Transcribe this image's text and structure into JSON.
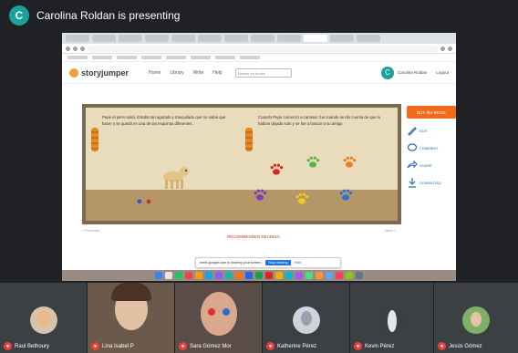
{
  "presenter": {
    "avatar_letter": "C",
    "text": "Carolina Roldan is presenting"
  },
  "storyjumper": {
    "logo": "storyjumper",
    "nav": [
      "Home",
      "Library",
      "Write",
      "Help"
    ],
    "search_placeholder": "Search for books",
    "user_initial": "C",
    "user_name": "Carolina Roldan",
    "logout": "Logout"
  },
  "book": {
    "left_text": "Pepe el perro salió, Estaba tan agotado y trasquilado que no sabía qué hacer y se quedó en una de las esquinas diferentes.",
    "right_text": "Cuando Pepe comenzó a caminar, fue cuando se dio cuenta de que lo habían dejado solo y se fue a buscar a su amigo.",
    "footer_link": "RECOMMENDED READING",
    "pager_left": "« Previous",
    "pager_right": "Next »"
  },
  "side_actions": {
    "buy": "BUY this BOOK",
    "items": [
      "EDIT",
      "COMMENT",
      "SHARE",
      "DOWNLOAD"
    ]
  },
  "share_notice": {
    "text": "meet.google.com is sharing your screen.",
    "stop": "Stop sharing",
    "hide": "Hide"
  },
  "participants": [
    {
      "name": "Raul Bethoury",
      "video": false
    },
    {
      "name": "Lina Isabel P",
      "video": true
    },
    {
      "name": "Sara Gómez Mor",
      "video": true
    },
    {
      "name": "Katherine Pérez",
      "video": false
    },
    {
      "name": "Kevin Pérez",
      "video": false
    },
    {
      "name": "Jesús Gómez",
      "video": false
    }
  ],
  "colors": {
    "accent_teal": "#1aa39a",
    "buy_orange": "#f26b1d",
    "mic_red": "#ea4335"
  }
}
